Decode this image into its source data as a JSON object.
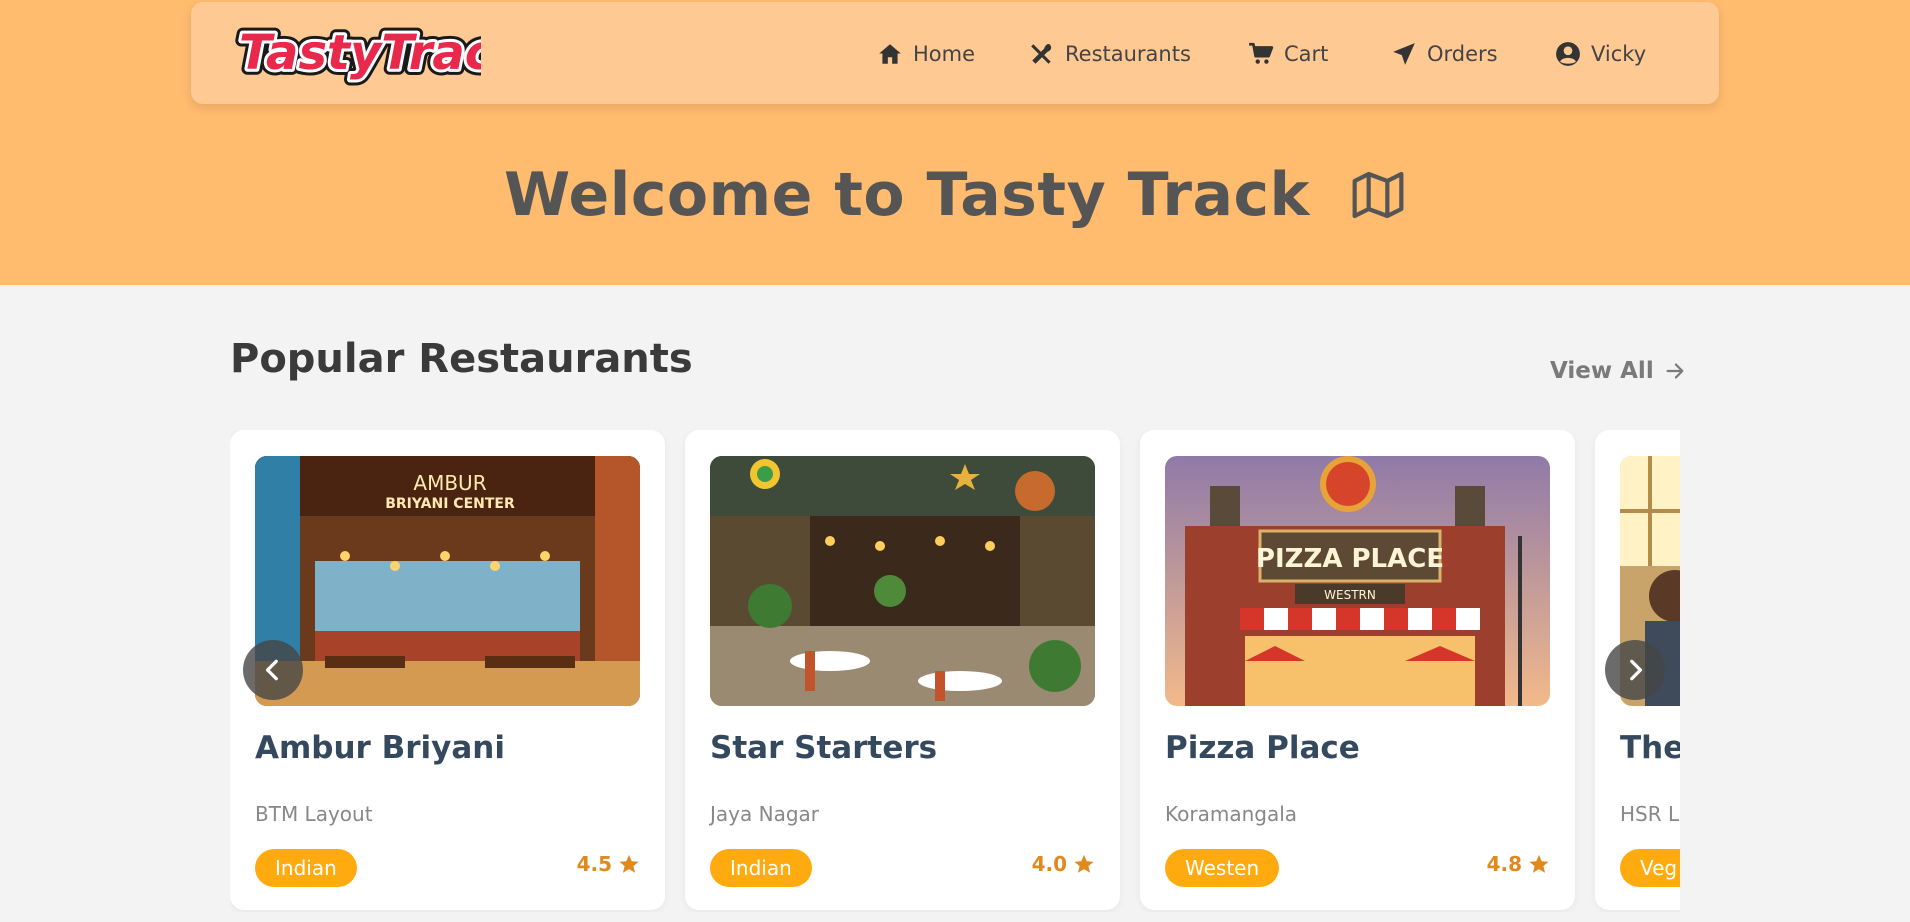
{
  "app": {
    "logo_text": "TastyTrack"
  },
  "nav": {
    "items": [
      {
        "label": "Home",
        "icon": "home-icon"
      },
      {
        "label": "Restaurants",
        "icon": "utensils-icon"
      },
      {
        "label": "Cart",
        "icon": "cart-icon"
      },
      {
        "label": "Orders",
        "icon": "paper-plane-icon"
      },
      {
        "label": "Vicky",
        "icon": "user-circle-icon"
      }
    ]
  },
  "hero": {
    "title": "Welcome to Tasty Track",
    "icon": "map-icon"
  },
  "section": {
    "title": "Popular Restaurants",
    "view_all": "View All"
  },
  "restaurants": [
    {
      "name": "Ambur Briyani",
      "location": "BTM Layout",
      "cuisine": "Indian",
      "rating": "4.5",
      "image_sign": "AMBUR",
      "image_sign2": "BRIYANI CENTER"
    },
    {
      "name": "Star Starters",
      "location": "Jaya Nagar",
      "cuisine": "Indian",
      "rating": "4.0"
    },
    {
      "name": "Pizza Place",
      "location": "Koramangala",
      "cuisine": "Westen",
      "rating": "4.8",
      "image_sign": "PIZZA PLACE",
      "image_sign2": "WESTRN"
    },
    {
      "name": "The",
      "location": "HSR La",
      "cuisine": "Veg",
      "rating": ""
    }
  ],
  "colors": {
    "hero_bg": "#ffbb6e",
    "navbar_bg": "#ffc994",
    "badge": "#ffab10",
    "rating": "#e08a1e",
    "card_title": "#34495e",
    "logo_fill": "#e8294b"
  }
}
